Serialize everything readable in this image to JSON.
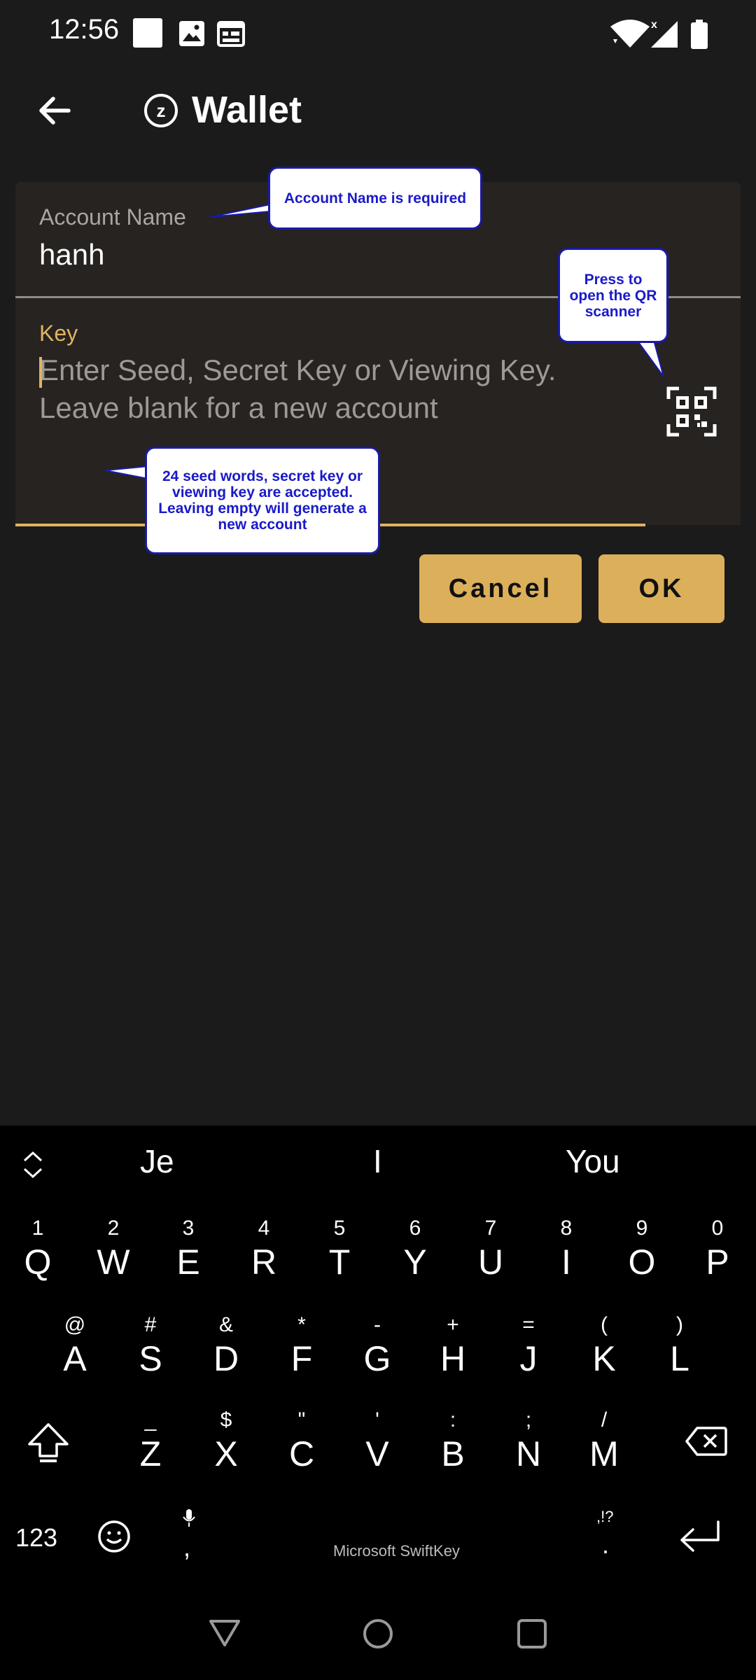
{
  "status_bar": {
    "time": "12:56",
    "icons": [
      "square-icon",
      "image-icon",
      "calendar-icon",
      "wifi-icon",
      "signal-icon",
      "battery-icon"
    ]
  },
  "app_bar": {
    "title": "Wallet",
    "back_icon": "back-arrow-icon",
    "logo_icon": "zcash-logo-icon",
    "logo_letter": "z"
  },
  "form": {
    "account_name_label": "Account Name",
    "account_name_value": "hanh",
    "key_label": "Key",
    "key_placeholder": "Enter Seed, Secret Key or Viewing Key. Leave blank for a new account",
    "qr_icon": "qr-scanner-icon"
  },
  "buttons": {
    "cancel": "Cancel",
    "ok": "OK"
  },
  "callouts": {
    "account_name": "Account Name is required",
    "qr": "Press to open the QR scanner",
    "key": "24 seed words, secret key or viewing key are accepted. Leaving empty will generate a new account"
  },
  "keyboard": {
    "suggestions": [
      "Je",
      "I",
      "You"
    ],
    "row1": [
      {
        "hint": "1",
        "key": "Q"
      },
      {
        "hint": "2",
        "key": "W"
      },
      {
        "hint": "3",
        "key": "E"
      },
      {
        "hint": "4",
        "key": "R"
      },
      {
        "hint": "5",
        "key": "T"
      },
      {
        "hint": "6",
        "key": "Y"
      },
      {
        "hint": "7",
        "key": "U"
      },
      {
        "hint": "8",
        "key": "I"
      },
      {
        "hint": "9",
        "key": "O"
      },
      {
        "hint": "0",
        "key": "P"
      }
    ],
    "row2": [
      {
        "hint": "@",
        "key": "A"
      },
      {
        "hint": "#",
        "key": "S"
      },
      {
        "hint": "&",
        "key": "D"
      },
      {
        "hint": "*",
        "key": "F"
      },
      {
        "hint": "-",
        "key": "G"
      },
      {
        "hint": "+",
        "key": "H"
      },
      {
        "hint": "=",
        "key": "J"
      },
      {
        "hint": "(",
        "key": "K"
      },
      {
        "hint": ")",
        "key": "L"
      }
    ],
    "row3": [
      {
        "hint": "_",
        "key": "Z"
      },
      {
        "hint": "$",
        "key": "X"
      },
      {
        "hint": "\"",
        "key": "C"
      },
      {
        "hint": "'",
        "key": "V"
      },
      {
        "hint": ":",
        "key": "B"
      },
      {
        "hint": ";",
        "key": "N"
      },
      {
        "hint": "/",
        "key": "M"
      }
    ],
    "numbers_key": "123",
    "comma_key": ",",
    "period_key": ".",
    "period_hint": ",!?",
    "brand": "Microsoft SwiftKey"
  }
}
